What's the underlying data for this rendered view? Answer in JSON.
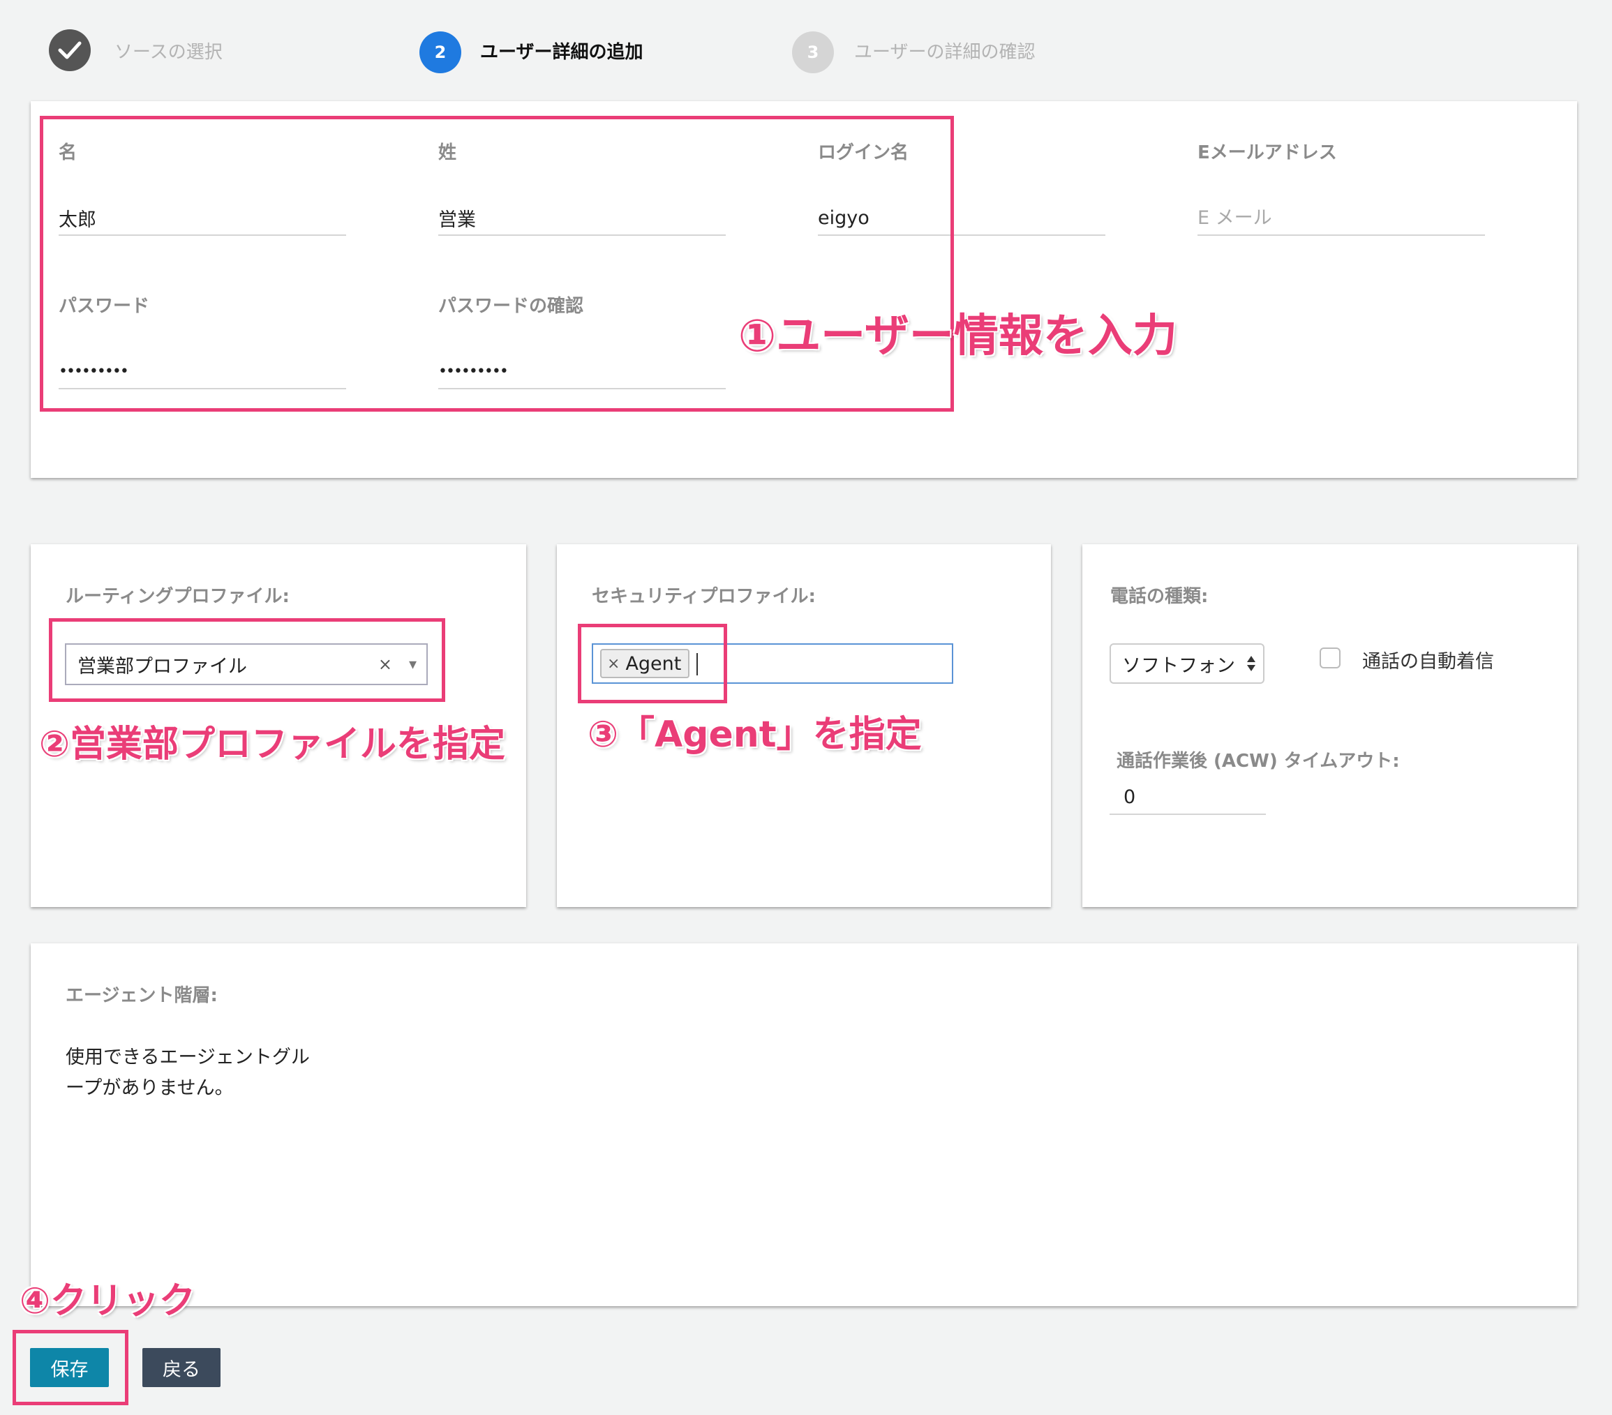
{
  "stepper": {
    "step1": {
      "label": "ソースの選択"
    },
    "step2": {
      "number": "2",
      "label": "ユーザー詳細の追加"
    },
    "step3": {
      "number": "3",
      "label": "ユーザーの詳細の確認"
    }
  },
  "user_info": {
    "first_name": {
      "label": "名",
      "value": "太郎"
    },
    "last_name": {
      "label": "姓",
      "value": "営業"
    },
    "login_name": {
      "label": "ログイン名",
      "value": "eigyo"
    },
    "email": {
      "label": "Eメールアドレス",
      "placeholder": "E メール"
    },
    "password": {
      "label": "パスワード",
      "value": "•••••••••"
    },
    "password_confirm": {
      "label": "パスワードの確認",
      "value": "•••••••••"
    }
  },
  "routing": {
    "label": "ルーティングプロファイル:",
    "selected": "営業部プロファイル",
    "clear": "×",
    "arrow": "▾"
  },
  "security": {
    "label": "セキュリティプロファイル:",
    "tag": "Agent",
    "tag_remove": "×"
  },
  "phone": {
    "label": "電話の種類:",
    "selected": "ソフトフォン",
    "auto_accept_label": "通話の自動着信",
    "acw_label": "通話作業後 (ACW) タイムアウト:",
    "acw_value": "0"
  },
  "hierarchy": {
    "label": "エージェント階層:",
    "empty_line1": "使用できるエージェントグル",
    "empty_line2": "ープがありません。"
  },
  "buttons": {
    "save": "保存",
    "back": "戻る"
  },
  "annotations": {
    "a1": "①ユーザー情報を入力",
    "a2": "②営業部プロファイルを指定",
    "a3": "③「Agent」を指定",
    "a4": "④クリック"
  },
  "colors": {
    "accent": "#ea3d77",
    "step_active": "#1f7ae0",
    "save_button": "#0e86a8",
    "back_button": "#3c4a5c"
  }
}
